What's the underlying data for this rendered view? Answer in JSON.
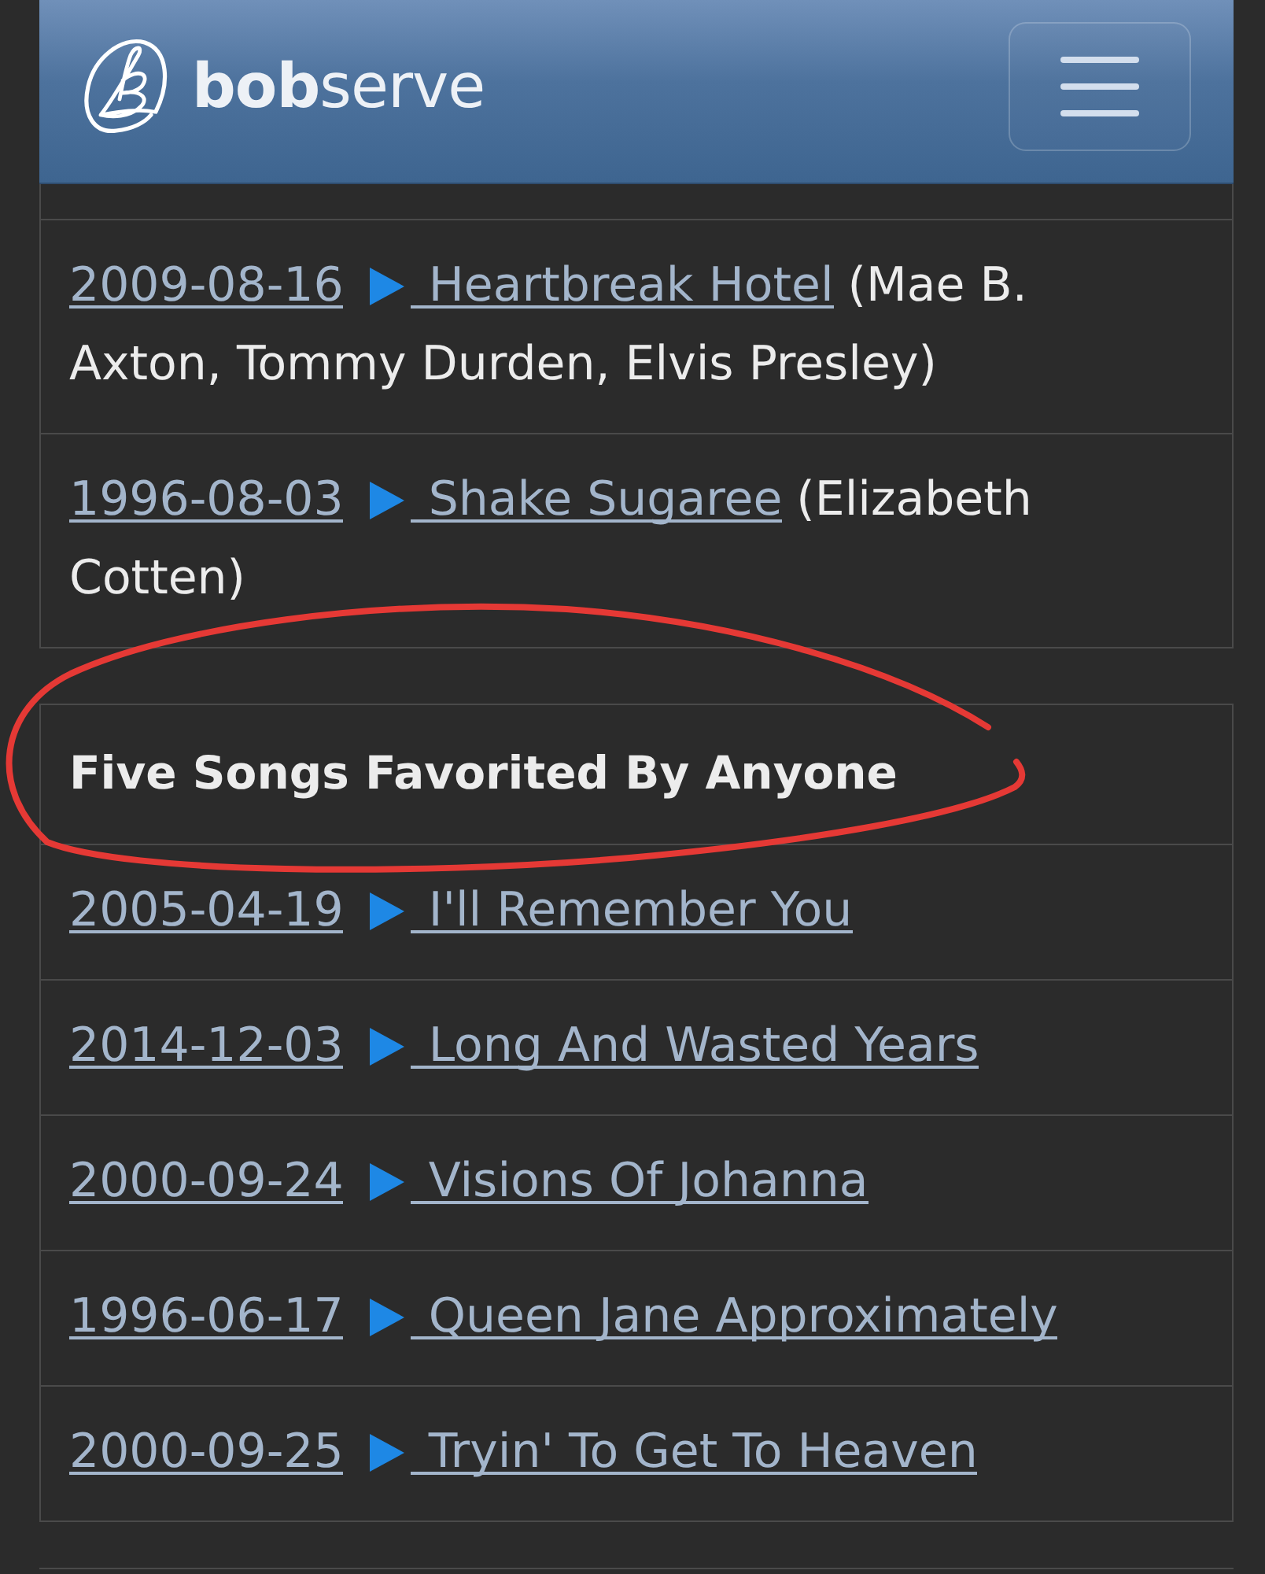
{
  "navbar": {
    "brand": "**bob**serve"
  },
  "recent_songs": [
    {
      "date": "2009-08-16",
      "title": "Heartbreak Hotel",
      "artists": "(Mae B. Axton, Tommy Durden, Elvis Presley)"
    },
    {
      "date": "1996-08-03",
      "title": "Shake Sugaree",
      "artists": "(Elizabeth Cotten)"
    }
  ],
  "favorites": {
    "heading": "Five Songs Favorited By Anyone",
    "songs": [
      {
        "date": "2005-04-19",
        "title": "I'll Remember You"
      },
      {
        "date": "2014-12-03",
        "title": "Long And Wasted Years"
      },
      {
        "date": "2000-09-24",
        "title": "Visions Of Johanna"
      },
      {
        "date": "1996-06-17",
        "title": "Queen Jane Approximately"
      },
      {
        "date": "2000-09-25",
        "title": "Tryin' To Get To Heaven"
      }
    ]
  }
}
